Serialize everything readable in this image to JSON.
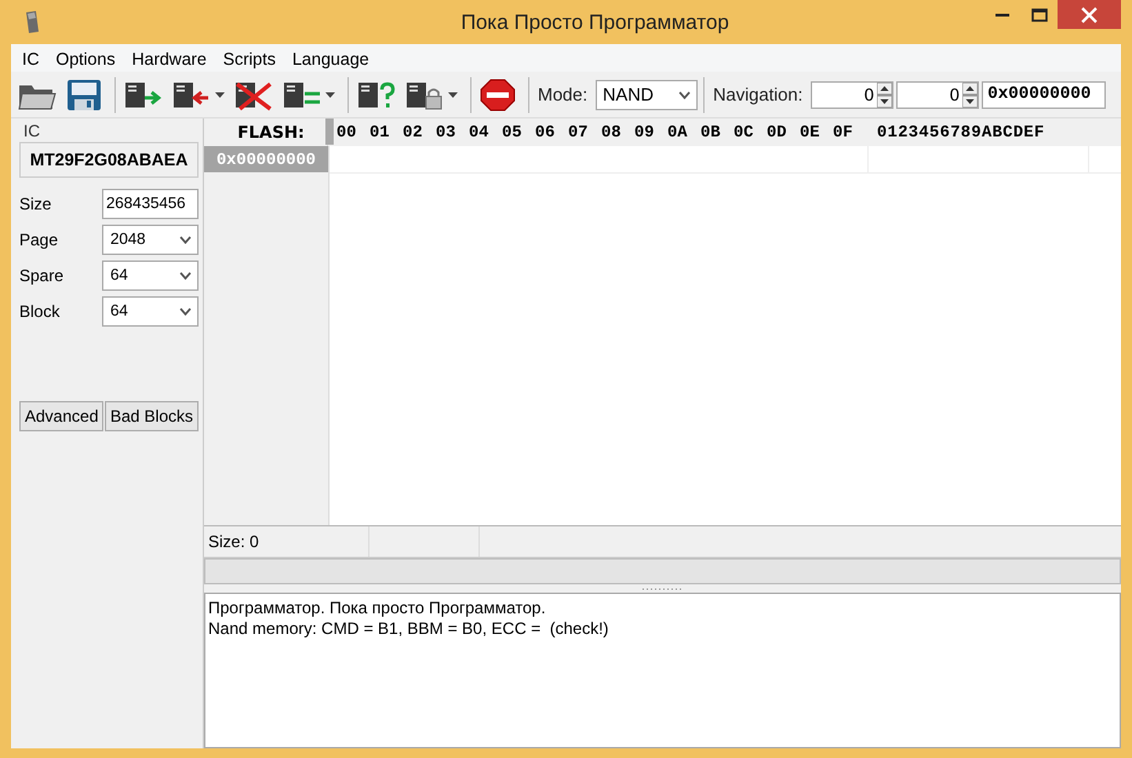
{
  "window": {
    "title": "Пока Просто Программатор"
  },
  "menu": [
    "IC",
    "Options",
    "Hardware",
    "Scripts",
    "Language"
  ],
  "toolbar": {
    "mode_label": "Mode:",
    "mode_value": "NAND",
    "navigation_label": "Navigation:",
    "spin_values": [
      "0",
      "0"
    ],
    "address": "0x00000000"
  },
  "ic": {
    "group_label": "IC",
    "chip": "MT29F2G08ABAEA",
    "fields": [
      {
        "label": "Size",
        "value": "268435456",
        "kind": "text"
      },
      {
        "label": "Page",
        "value": "2048",
        "kind": "select"
      },
      {
        "label": "Spare",
        "value": "64",
        "kind": "select"
      },
      {
        "label": "Block",
        "value": "64",
        "kind": "select"
      }
    ],
    "buttons": [
      "Advanced",
      "Bad Blocks"
    ]
  },
  "hex": {
    "corner": "FLASH:",
    "columns": [
      "00",
      "01",
      "02",
      "03",
      "04",
      "05",
      "06",
      "07",
      "08",
      "09",
      "0A",
      "0B",
      "0C",
      "0D",
      "0E",
      "0F"
    ],
    "ascii_header": "0123456789ABCDEF",
    "rows": [
      {
        "address": "0x00000000",
        "selected": true
      }
    ]
  },
  "status_bar": [
    "Size: 0"
  ],
  "progress": {
    "level": 0
  },
  "log": [
    "Программатор. Пока просто Программатор.",
    "Nand memory: CMD = B1, BBM = B0, ECC =  (check!)"
  ]
}
